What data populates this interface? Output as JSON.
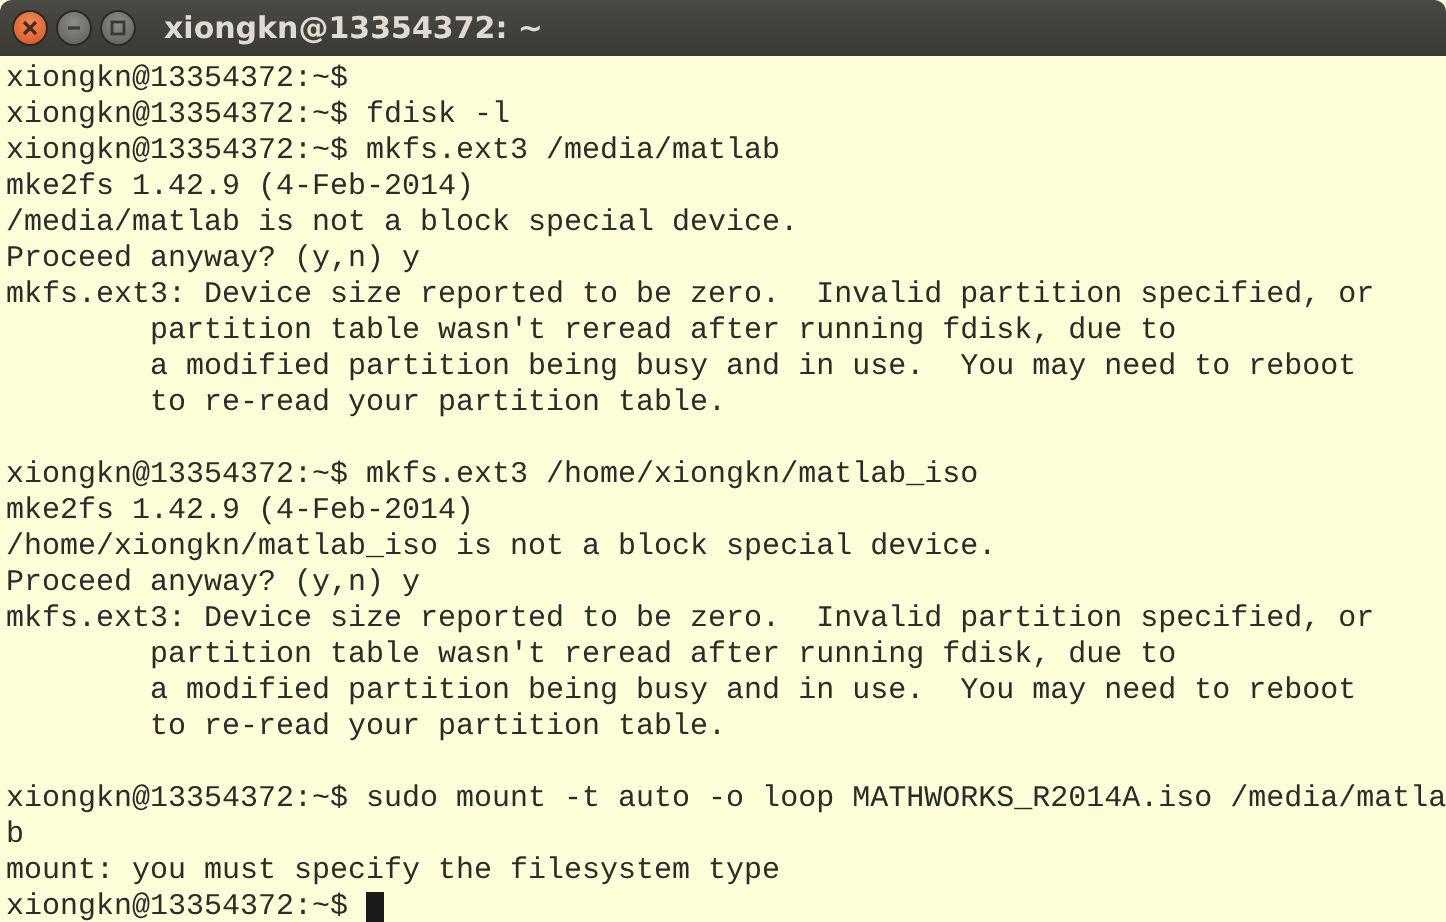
{
  "window": {
    "title": "xiongkn@13354372: ~"
  },
  "terminal": {
    "cursor": true,
    "blocks": [
      {
        "lines": [
          "xiongkn@13354372:~$",
          "xiongkn@13354372:~$ fdisk -l",
          "xiongkn@13354372:~$ mkfs.ext3 /media/matlab",
          "mke2fs 1.42.9 (4-Feb-2014)",
          "/media/matlab is not a block special device.",
          "Proceed anyway? (y,n) y",
          "mkfs.ext3: Device size reported to be zero.  Invalid partition specified, or",
          "        partition table wasn't reread after running fdisk, due to",
          "        a modified partition being busy and in use.  You may need to reboot",
          "        to re-read your partition table."
        ]
      },
      {
        "lines": [
          "xiongkn@13354372:~$ mkfs.ext3 /home/xiongkn/matlab_iso",
          "mke2fs 1.42.9 (4-Feb-2014)",
          "/home/xiongkn/matlab_iso is not a block special device.",
          "Proceed anyway? (y,n) y",
          "mkfs.ext3: Device size reported to be zero.  Invalid partition specified, or",
          "        partition table wasn't reread after running fdisk, due to",
          "        a modified partition being busy and in use.  You may need to reboot",
          "        to re-read your partition table."
        ]
      },
      {
        "lines": [
          "xiongkn@13354372:~$ sudo mount -t auto -o loop MATHWORKS_R2014A.iso /media/matla",
          "b",
          "mount: you must specify the filesystem type",
          "xiongkn@13354372:~$ "
        ]
      }
    ]
  }
}
